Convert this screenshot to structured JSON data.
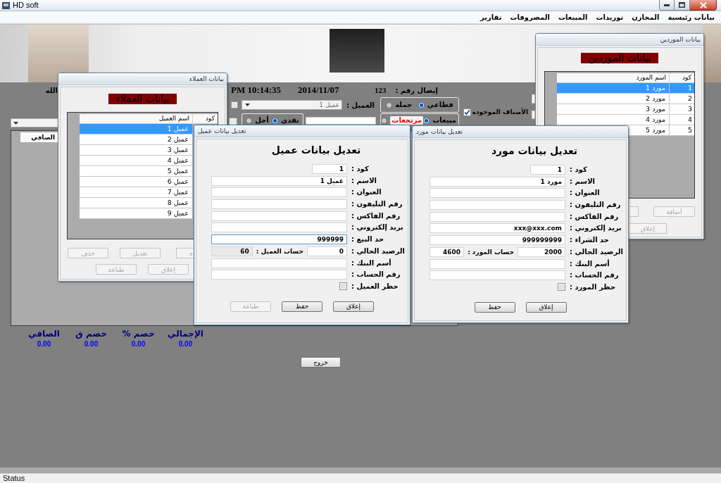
{
  "window": {
    "title": "HD soft"
  },
  "menu": [
    {
      "label": "بيانات رئيسية"
    },
    {
      "label": "المخازن"
    },
    {
      "label": "توريدات"
    },
    {
      "label": "المبيعات"
    },
    {
      "label": "المصروفات"
    },
    {
      "label": "تقارير"
    }
  ],
  "sales_form": {
    "header_text": "الله",
    "time": "PM 10:14:35",
    "date": "2014/11/07",
    "receipt_number": "123",
    "receipt_label": "إيصال رقم :",
    "customer_checkbox": {
      "checked": false
    },
    "customer_label": "العميل :",
    "customer_value": "عميل 1",
    "price_type": [
      {
        "label": "قطاعي",
        "selected": true
      },
      {
        "label": "جملة",
        "selected": false
      }
    ],
    "available_items": {
      "label": "الأصناف الموجوده",
      "checked": true
    },
    "payment_type": [
      {
        "label": "نقدي",
        "selected": true
      },
      {
        "label": "أجل",
        "selected": false
      }
    ],
    "invoice_type": [
      {
        "label": "مبيعات",
        "selected": true,
        "color": "#000000"
      },
      {
        "label": "مرتجعات",
        "selected": false,
        "color": "#ff0000"
      }
    ],
    "grid_columns": [
      "الصافي"
    ],
    "totals": [
      {
        "label": "الإجمالي",
        "value": "0.00"
      },
      {
        "label": "حصم %",
        "value": "0.00"
      },
      {
        "label": "خصم ق",
        "value": "0.00"
      },
      {
        "label": "الصافي",
        "value": "0.00"
      }
    ],
    "exit_button": "خروج"
  },
  "customers_window": {
    "title": "بيانات العملاء",
    "heading": "بيانات العملاء",
    "columns": [
      "كود",
      "اسم العميل"
    ],
    "rows": [
      {
        "name": "عميل 1",
        "selected": true
      },
      {
        "name": "عميل 2",
        "selected": false
      },
      {
        "name": "عميل 3",
        "selected": false
      },
      {
        "name": "عميل 4",
        "selected": false
      },
      {
        "name": "عميل 5",
        "selected": false
      },
      {
        "name": "عميل 6",
        "selected": false
      },
      {
        "name": "عميل 7",
        "selected": false
      },
      {
        "name": "عميل 8",
        "selected": false
      },
      {
        "name": "عميل 9",
        "selected": false
      }
    ],
    "buttons": [
      {
        "label": "ه",
        "disabled": true
      },
      {
        "label": "تعديل",
        "disabled": true
      },
      {
        "label": "حذف",
        "disabled": true
      },
      {
        "label": "إعلاق",
        "disabled": true
      },
      {
        "label": "طباعة",
        "disabled": true
      }
    ]
  },
  "customer_edit_window": {
    "title": "تعديل بيانات عميل",
    "heading": "تعديل بيانات عميل",
    "fields": [
      {
        "kind": "short",
        "label": "كود :",
        "value": "1",
        "focused": false
      },
      {
        "kind": "text",
        "label": "الاسم :",
        "value": "عميل 1",
        "focused": false
      },
      {
        "kind": "text",
        "label": "العنوان :",
        "focused": false
      },
      {
        "kind": "text",
        "label": "رقم التليفون :",
        "focused": false
      },
      {
        "kind": "text",
        "label": "رقم الفاكس :",
        "focused": false
      },
      {
        "kind": "text",
        "label": "بريد إلكتروني :",
        "focused": false
      },
      {
        "kind": "text",
        "label": "حد البيع :",
        "value": "999999",
        "focused": true
      },
      {
        "kind": "balance",
        "label": "الرصيد الحالي :",
        "value": "0",
        "focused": false,
        "account_label": "حساب العميل :",
        "account_value": "60",
        "account_disabled": true
      },
      {
        "kind": "text",
        "label": "أسم البنك :",
        "focused": false
      },
      {
        "kind": "text",
        "label": "رقم الحساب :",
        "focused": false
      },
      {
        "kind": "checkbox",
        "label": "حظر العميل :",
        "checked": false
      }
    ],
    "buttons": [
      {
        "label": "إعلاق",
        "disabled": false
      },
      {
        "label": "حفظ",
        "disabled": false
      },
      {
        "label": "طباعة",
        "disabled": true
      }
    ]
  },
  "suppliers_window": {
    "title": "بيانات الموردين",
    "heading": "بيانات الموردين",
    "columns": [
      "كود",
      "اسم المورد"
    ],
    "rows": [
      {
        "code": "1",
        "name": "مورد 1",
        "selected": true
      },
      {
        "code": "2",
        "name": "مورد 2",
        "selected": false
      },
      {
        "code": "3",
        "name": "مورد 3",
        "selected": false
      },
      {
        "code": "4",
        "name": "مورد 4",
        "selected": false
      },
      {
        "code": "5",
        "name": "مورد 5",
        "selected": false
      }
    ],
    "buttons": [
      {
        "label": "أضافة",
        "disabled": true
      },
      {
        "label": "إعلاق",
        "disabled": true
      }
    ]
  },
  "supplier_edit_window": {
    "title": "تعديل بيانات مورد",
    "heading": "تعديل بيانات مورد",
    "fields": [
      {
        "kind": "short",
        "label": "كود :",
        "value": "1",
        "focused": false
      },
      {
        "kind": "text",
        "label": "الاسم :",
        "value": "مورد 1",
        "focused": false
      },
      {
        "kind": "text",
        "label": "العنوان :",
        "focused": false
      },
      {
        "kind": "text",
        "label": "رقم التليفون :",
        "focused": false
      },
      {
        "kind": "text",
        "label": "رقم الفاكس :",
        "focused": false
      },
      {
        "kind": "text",
        "label": "بريد إلكتروني :",
        "value": "xxx@xxx.com",
        "focused": false
      },
      {
        "kind": "text",
        "label": "حد الشراء :",
        "value": "999999999",
        "focused": false
      },
      {
        "kind": "balance",
        "label": "الرصيد الحالي :",
        "value": "2000",
        "focused": false,
        "account_label": "حساب المورد :",
        "account_value": "4600",
        "account_disabled": false
      },
      {
        "kind": "text",
        "label": "أسم البنك :",
        "focused": false
      },
      {
        "kind": "text",
        "label": "رقم الحساب :",
        "focused": false
      },
      {
        "kind": "checkbox",
        "label": "حظر المورد :",
        "checked": false
      }
    ],
    "buttons": [
      {
        "label": "إعلاق",
        "disabled": false
      },
      {
        "label": "حفظ",
        "disabled": false
      }
    ]
  },
  "status_bar": {
    "text": "Status"
  }
}
